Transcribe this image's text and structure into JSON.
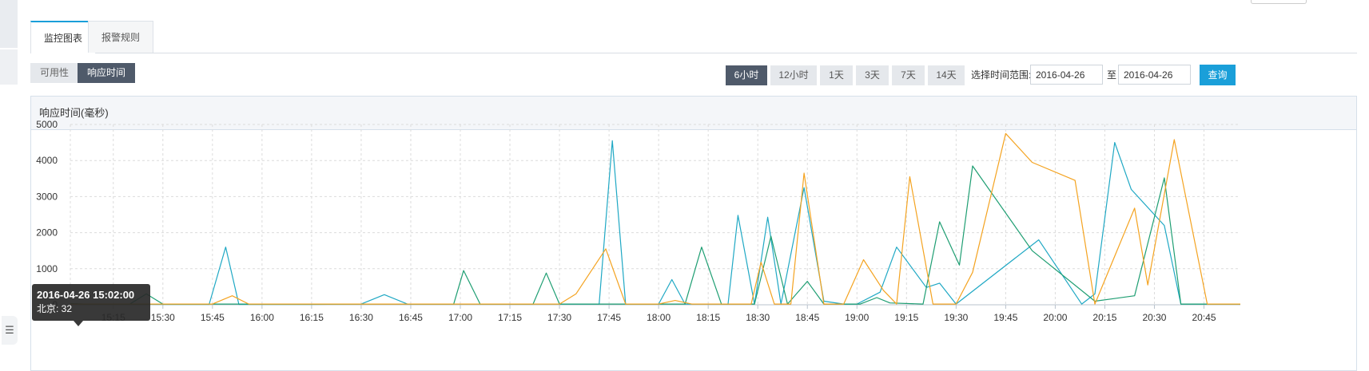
{
  "tabs": [
    {
      "label": "监控图表",
      "active": true
    },
    {
      "label": "报警规则",
      "active": false
    }
  ],
  "segments": [
    {
      "label": "可用性",
      "active": false
    },
    {
      "label": "响应时间",
      "active": true
    }
  ],
  "range_buttons": [
    {
      "label": "6小时",
      "active": true
    },
    {
      "label": "12小时",
      "active": false
    },
    {
      "label": "1天",
      "active": false
    },
    {
      "label": "3天",
      "active": false
    },
    {
      "label": "7天",
      "active": false
    },
    {
      "label": "14天",
      "active": false
    }
  ],
  "range": {
    "label": "选择时间范围:",
    "start": "2016-04-26",
    "to": "至",
    "end": "2016-04-26",
    "query": "查询"
  },
  "panel": {
    "title": "响应时间(毫秒)"
  },
  "tooltip": {
    "time": "2016-04-26 15:02:00",
    "value": "北京: 32"
  },
  "side_handle_icon": "list-icon",
  "colors": {
    "accent": "#1a9fd9",
    "series_cyan": "#1fa8c4",
    "series_green": "#1e9e72",
    "series_orange": "#f4a320"
  },
  "chart_data": {
    "type": "line",
    "title": "响应时间(毫秒)",
    "ylim": [
      0,
      5000
    ],
    "yticks": [
      0,
      1000,
      2000,
      3000,
      4000,
      5000
    ],
    "xticks": [
      "15:15",
      "15:30",
      "15:45",
      "16:00",
      "16:15",
      "16:30",
      "16:45",
      "17:00",
      "17:15",
      "17:30",
      "17:45",
      "18:00",
      "18:15",
      "18:30",
      "18:45",
      "19:00",
      "19:15",
      "19:30",
      "19:45",
      "20:00",
      "20:15",
      "20:30",
      "20:45"
    ],
    "x_start": "15:02",
    "x_end": "20:56",
    "grid": true,
    "series": [
      {
        "color": "#1fa8c4",
        "points": [
          [
            "15:02",
            32
          ],
          [
            "15:06",
            20
          ],
          [
            "15:30",
            10
          ],
          [
            "15:44",
            10
          ],
          [
            "15:49",
            1600
          ],
          [
            "15:53",
            10
          ],
          [
            "16:15",
            10
          ],
          [
            "16:30",
            20
          ],
          [
            "16:37",
            280
          ],
          [
            "16:44",
            20
          ],
          [
            "17:30",
            20
          ],
          [
            "17:42",
            20
          ],
          [
            "17:46",
            4550
          ],
          [
            "17:50",
            20
          ],
          [
            "18:00",
            20
          ],
          [
            "18:04",
            700
          ],
          [
            "18:08",
            20
          ],
          [
            "18:21",
            20
          ],
          [
            "18:24",
            2480
          ],
          [
            "18:29",
            20
          ],
          [
            "18:33",
            2430
          ],
          [
            "18:37",
            20
          ],
          [
            "18:44",
            3250
          ],
          [
            "18:50",
            100
          ],
          [
            "18:56",
            20
          ],
          [
            "19:00",
            20
          ],
          [
            "19:07",
            350
          ],
          [
            "19:12",
            1600
          ],
          [
            "19:21",
            480
          ],
          [
            "19:25",
            600
          ],
          [
            "19:30",
            20
          ],
          [
            "19:55",
            1800
          ],
          [
            "20:08",
            20
          ],
          [
            "20:12",
            300
          ],
          [
            "20:18",
            4500
          ],
          [
            "20:23",
            3200
          ],
          [
            "20:33",
            2200
          ],
          [
            "20:38",
            20
          ],
          [
            "20:56",
            20
          ]
        ]
      },
      {
        "color": "#1e9e72",
        "points": [
          [
            "15:02",
            32
          ],
          [
            "15:06",
            20
          ],
          [
            "15:20",
            20
          ],
          [
            "15:25",
            300
          ],
          [
            "15:30",
            20
          ],
          [
            "16:00",
            20
          ],
          [
            "16:45",
            20
          ],
          [
            "16:58",
            20
          ],
          [
            "17:01",
            950
          ],
          [
            "17:06",
            20
          ],
          [
            "17:22",
            20
          ],
          [
            "17:26",
            880
          ],
          [
            "17:30",
            20
          ],
          [
            "18:02",
            20
          ],
          [
            "18:08",
            20
          ],
          [
            "18:13",
            1600
          ],
          [
            "18:19",
            20
          ],
          [
            "18:29",
            20
          ],
          [
            "18:34",
            1900
          ],
          [
            "18:39",
            20
          ],
          [
            "18:45",
            650
          ],
          [
            "18:50",
            20
          ],
          [
            "19:01",
            20
          ],
          [
            "19:06",
            200
          ],
          [
            "19:10",
            50
          ],
          [
            "19:20",
            20
          ],
          [
            "19:25",
            2300
          ],
          [
            "19:31",
            1100
          ],
          [
            "19:35",
            3850
          ],
          [
            "19:53",
            1500
          ],
          [
            "20:12",
            100
          ],
          [
            "20:24",
            250
          ],
          [
            "20:33",
            3520
          ],
          [
            "20:38",
            20
          ],
          [
            "20:56",
            20
          ]
        ]
      },
      {
        "color": "#f4a320",
        "points": [
          [
            "15:02",
            20
          ],
          [
            "15:45",
            20
          ],
          [
            "15:51",
            250
          ],
          [
            "15:56",
            20
          ],
          [
            "16:30",
            20
          ],
          [
            "16:50",
            20
          ],
          [
            "17:10",
            20
          ],
          [
            "17:30",
            20
          ],
          [
            "17:35",
            300
          ],
          [
            "17:44",
            1550
          ],
          [
            "17:50",
            20
          ],
          [
            "18:00",
            20
          ],
          [
            "18:05",
            120
          ],
          [
            "18:10",
            20
          ],
          [
            "18:22",
            20
          ],
          [
            "18:28",
            20
          ],
          [
            "18:31",
            1180
          ],
          [
            "18:35",
            20
          ],
          [
            "18:40",
            20
          ],
          [
            "18:44",
            3650
          ],
          [
            "18:50",
            20
          ],
          [
            "18:56",
            20
          ],
          [
            "19:02",
            1250
          ],
          [
            "19:08",
            400
          ],
          [
            "19:12",
            20
          ],
          [
            "19:16",
            3550
          ],
          [
            "19:23",
            20
          ],
          [
            "19:30",
            20
          ],
          [
            "19:35",
            900
          ],
          [
            "19:45",
            4750
          ],
          [
            "19:53",
            3950
          ],
          [
            "20:06",
            3450
          ],
          [
            "20:12",
            20
          ],
          [
            "20:24",
            2680
          ],
          [
            "20:28",
            550
          ],
          [
            "20:36",
            4580
          ],
          [
            "20:46",
            20
          ],
          [
            "20:56",
            20
          ]
        ]
      }
    ]
  }
}
